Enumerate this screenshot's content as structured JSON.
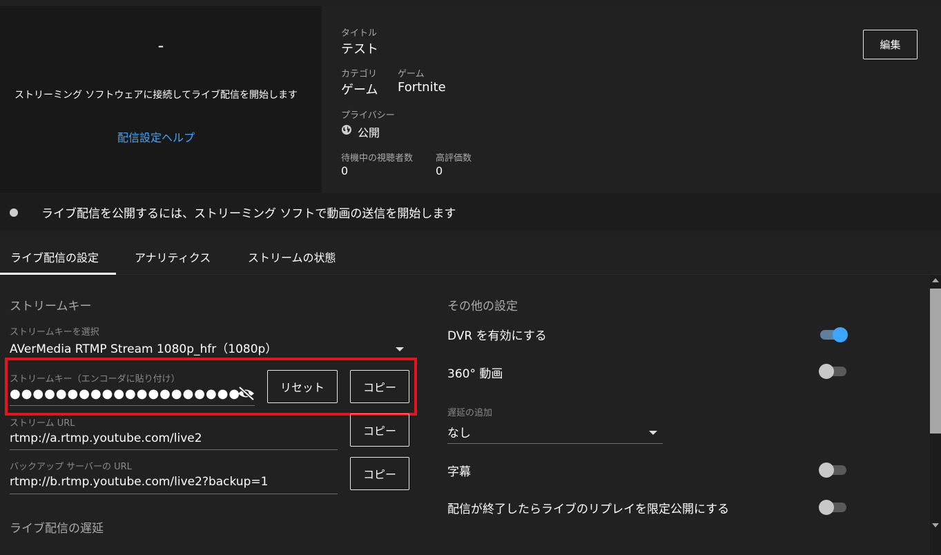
{
  "preview": {
    "dash": "-",
    "message": "ストリーミング ソフトウェアに接続してライブ配信を開始します",
    "help_link": "配信設定ヘルプ"
  },
  "info": {
    "title_label": "タイトル",
    "title_value": "テスト",
    "category_label": "カテゴリ",
    "category_value": "ゲーム",
    "game_label": "ゲーム",
    "game_value": "Fortnite",
    "privacy_label": "プライバシー",
    "privacy_value": "公開",
    "waiting_viewers_label": "待機中の視聴者数",
    "waiting_viewers_value": "0",
    "likes_label": "高評価数",
    "likes_value": "0",
    "edit_button": "編集"
  },
  "status": {
    "message": "ライブ配信を公開するには、ストリーミング ソフトで動画の送信を開始します"
  },
  "tabs": [
    {
      "label": "ライブ配信の設定",
      "active": true
    },
    {
      "label": "アナリティクス",
      "active": false
    },
    {
      "label": "ストリームの状態",
      "active": false
    }
  ],
  "stream_key_section": {
    "title": "ストリームキー",
    "select_label": "ストリームキーを選択",
    "select_value": "AVerMedia RTMP Stream 1080p_hfr（1080p）",
    "key_label": "ストリームキー（エンコーダに貼り付け）",
    "key_masked": "●●●●●●●●●●●●●●●●●●●●",
    "reset_button": "リセット",
    "copy_button": "コピー",
    "url_label": "ストリーム URL",
    "url_value": "rtmp://a.rtmp.youtube.com/live2",
    "backup_label": "バックアップ サーバーの URL",
    "backup_value": "rtmp://b.rtmp.youtube.com/live2?backup=1",
    "latency_title": "ライブ配信の遅延"
  },
  "other_settings": {
    "title": "その他の設定",
    "dvr_label": "DVR を有効にする",
    "dvr_on": true,
    "video360_label": "360° 動画",
    "video360_on": false,
    "delay_label": "遅延の追加",
    "delay_value": "なし",
    "captions_label": "字幕",
    "captions_on": false,
    "replay_label": "配信が終了したらライブのリプレイを限定公開にする",
    "replay_on": false
  },
  "colors": {
    "accent": "#3ea6ff",
    "highlight_border": "#e3161f",
    "background": "#212121"
  }
}
